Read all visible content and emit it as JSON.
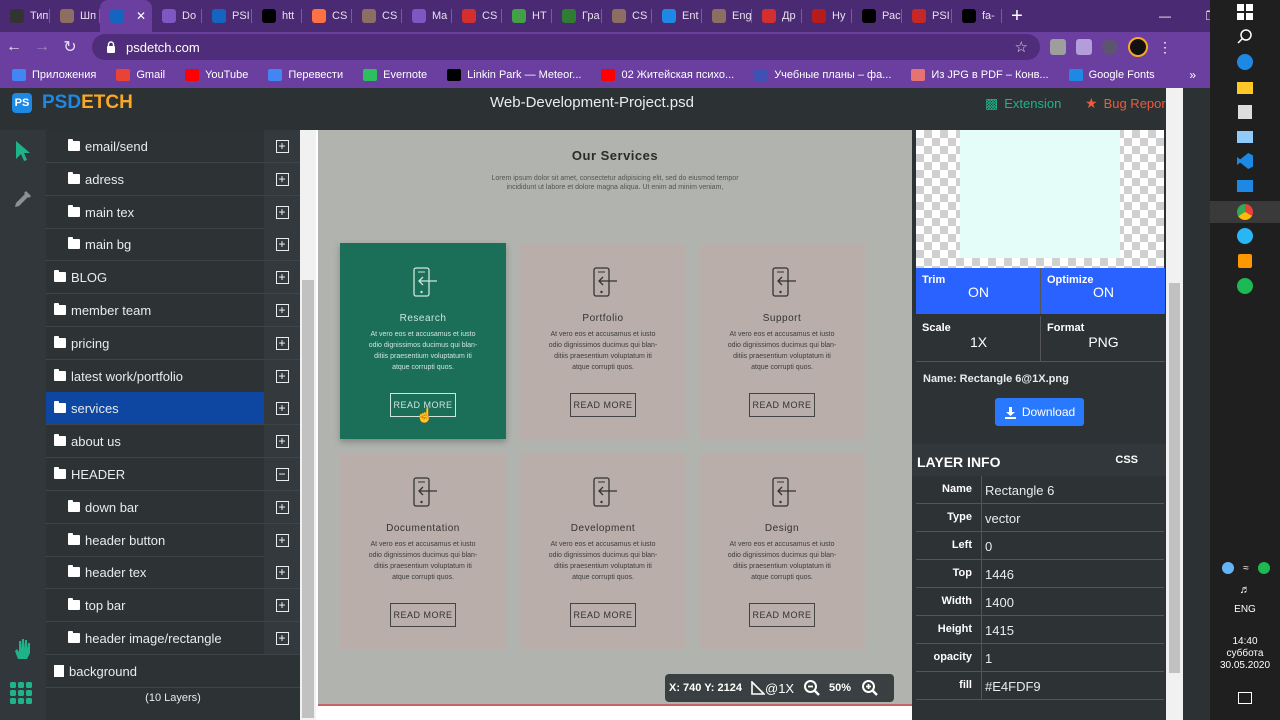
{
  "browser": {
    "tabs": [
      {
        "label": "Тип",
        "color": "#333"
      },
      {
        "label": "Шп",
        "color": "#8d6e63"
      },
      {
        "label": "",
        "color": "#1565c0",
        "active": true
      },
      {
        "label": "Do",
        "color": "#7e57c2"
      },
      {
        "label": "PSI",
        "color": "#1565c0"
      },
      {
        "label": "htt",
        "color": "#000"
      },
      {
        "label": "CS",
        "color": "#ff7043"
      },
      {
        "label": "CS",
        "color": "#8d6e63"
      },
      {
        "label": "Ma",
        "color": "#7e57c2"
      },
      {
        "label": "CS",
        "color": "#d32f2f"
      },
      {
        "label": "HT",
        "color": "#43a047"
      },
      {
        "label": "Гра",
        "color": "#2e7d32"
      },
      {
        "label": "CS",
        "color": "#8d6e63"
      },
      {
        "label": "Ent",
        "color": "#1e88e5"
      },
      {
        "label": "Eng",
        "color": "#8d6e63"
      },
      {
        "label": "Др",
        "color": "#d32f2f"
      },
      {
        "label": "Ну",
        "color": "#b71c1c"
      },
      {
        "label": "Рас",
        "color": "#000"
      },
      {
        "label": "PSI",
        "color": "#c62828"
      },
      {
        "label": "fa-",
        "color": "#000"
      }
    ],
    "url": "psdetch.com",
    "bookmarks": [
      {
        "label": "Приложения",
        "color": "#4285f4"
      },
      {
        "label": "Gmail",
        "color": "#ea4335"
      },
      {
        "label": "YouTube",
        "color": "#ff0000"
      },
      {
        "label": "Перевести",
        "color": "#4285f4"
      },
      {
        "label": "Evernote",
        "color": "#2dbe60"
      },
      {
        "label": "Linkin Park — Meteor...",
        "color": "#000000"
      },
      {
        "label": "02 Житейская психо...",
        "color": "#ff0000"
      },
      {
        "label": "Учебные планы – фа...",
        "color": "#3f51b5"
      },
      {
        "label": "Из JPG в PDF – Конв...",
        "color": "#e57373"
      },
      {
        "label": "Google Fonts",
        "color": "#1e88e5"
      }
    ],
    "bookmarks_more": "»"
  },
  "app": {
    "logo_prefix": "PS",
    "logo_part1": "PSD",
    "logo_part2": "ETCH",
    "file_title": "Web-Development-Project.psd",
    "extension_label": "Extension",
    "bug_label": "Bug Report",
    "layers": [
      {
        "label": "email/send",
        "indent": 1,
        "icon": "plus"
      },
      {
        "label": "adress",
        "indent": 1,
        "icon": "plus"
      },
      {
        "label": "main tex",
        "indent": 1,
        "icon": "plus"
      },
      {
        "label": "main bg",
        "indent": 1,
        "icon": "plus"
      },
      {
        "label": "BLOG",
        "indent": 0,
        "icon": "plus"
      },
      {
        "label": "member team",
        "indent": 0,
        "icon": "plus"
      },
      {
        "label": "pricing",
        "indent": 0,
        "icon": "plus"
      },
      {
        "label": "latest work/portfolio",
        "indent": 0,
        "icon": "plus"
      },
      {
        "label": "services",
        "indent": 0,
        "icon": "plus",
        "selected": true
      },
      {
        "label": "about us",
        "indent": 0,
        "icon": "plus"
      },
      {
        "label": "HEADER",
        "indent": 0,
        "icon": "minus"
      },
      {
        "label": "down bar",
        "indent": 1,
        "icon": "plus"
      },
      {
        "label": "header button",
        "indent": 1,
        "icon": "plus"
      },
      {
        "label": "header tex",
        "indent": 1,
        "icon": "plus"
      },
      {
        "label": "top bar",
        "indent": 1,
        "icon": "plus"
      },
      {
        "label": "header image/rectangle",
        "indent": 1,
        "icon": "plus"
      },
      {
        "label": "background",
        "indent": 0,
        "icon": "none"
      }
    ],
    "layer_count": "(10 Layers)",
    "canvas": {
      "title": "Our Services",
      "desc_line1": "Lorem ipsum dolor sit amet, consectetur adipisicing elit, sed do eiusmod tempor",
      "desc_line2": "incididunt ut labore et dolore magna aliqua. Ut enim ad minim veniam,",
      "card_text_1": "At vero eos et accusamus et iusto",
      "card_text_2": "odio dignissimos ducimus qui blan-",
      "card_text_3": "ditiis praesentium voluptatum iti",
      "card_text_4": "atque corrupti quos.",
      "button": "READ MORE",
      "cards": [
        {
          "title": "Research",
          "active": true
        },
        {
          "title": "Portfolio"
        },
        {
          "title": "Support"
        },
        {
          "title": "Documentation"
        },
        {
          "title": "Development"
        },
        {
          "title": "Design"
        }
      ]
    },
    "status": {
      "coords": "X: 740  Y: 2124",
      "scale": "@1X",
      "zoom": "50%"
    },
    "export": {
      "trim_label": "Trim",
      "trim_value": "ON",
      "optimize_label": "Optimize",
      "optimize_value": "ON",
      "scale_label": "Scale",
      "scale_value": "1X",
      "format_label": "Format",
      "format_value": "PNG",
      "filename": "Name: Rectangle 6@1X.png",
      "download_label": "Download",
      "preview_color": "#E4FDF9"
    },
    "layer_info": {
      "title": "LAYER INFO",
      "css_label": "CSS",
      "rows": [
        {
          "k": "Name",
          "v": "Rectangle 6"
        },
        {
          "k": "Type",
          "v": "vector"
        },
        {
          "k": "Left",
          "v": "0"
        },
        {
          "k": "Top",
          "v": "1446"
        },
        {
          "k": "Width",
          "v": "1400"
        },
        {
          "k": "Height",
          "v": "1415"
        },
        {
          "k": "opacity",
          "v": "1"
        },
        {
          "k": "fill",
          "v": "#E4FDF9"
        }
      ]
    }
  },
  "taskbar": {
    "lang": "ENG",
    "time": "14:40",
    "day": "суббота",
    "date": "30.05.2020"
  }
}
